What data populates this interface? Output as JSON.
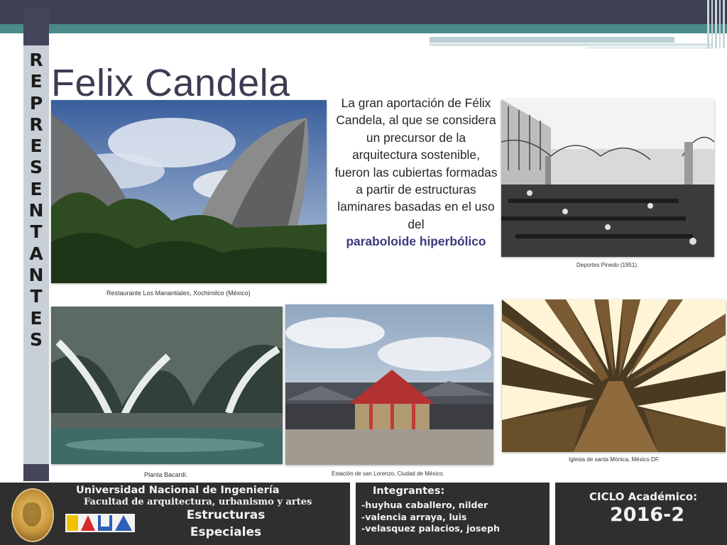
{
  "side_word": [
    "R",
    "E",
    "P",
    "R",
    "E",
    "S",
    "E",
    "N",
    "T",
    "A",
    "N",
    "T",
    "E",
    "S"
  ],
  "title": "Felix Candela",
  "description": {
    "text": "La gran aportación de Félix Candela, al que se considera un precursor de la arquitectura sostenible, fueron las cubiertas formadas a partir de estructuras laminares basadas en el uso del",
    "emphasis": "paraboloide hiperbólico"
  },
  "photos": {
    "manantiales": {
      "caption": "Restaurante Los Manantiales, Xochimilco (México)"
    },
    "pinedo": {
      "caption": "Deportes Pinedo (1951)."
    },
    "bacardi": {
      "caption": "Planta Bacardí."
    },
    "lorenzo": {
      "caption": "Estación de san Lorenzo, Ciudad de México."
    },
    "monica": {
      "caption": "Iglesia de santa Mónica, México DF."
    }
  },
  "footer": {
    "university": "Universidad Nacional de Ingeniería",
    "faculty": "Facultad de arquitectura, urbanismo y artes",
    "course_line1": "Estructuras",
    "course_line2": "Especiales",
    "members_title": "Integrantes:",
    "members": [
      "-huyhua caballero, nilder",
      "-valencia arraya, luis",
      "-velasquez palacios, joseph"
    ],
    "cycle_label": "CICLO Académico:",
    "cycle_value": "2016-2"
  }
}
